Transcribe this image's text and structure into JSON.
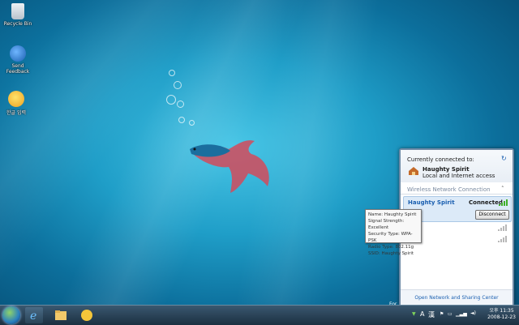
{
  "desktop": {
    "icons": [
      {
        "label": "Recycle Bin",
        "icon": "recycle-bin-icon"
      },
      {
        "label": "Send Feedback",
        "icon": "send-feedback-icon"
      },
      {
        "label": "한글 입력",
        "icon": "ime-app-icon"
      }
    ],
    "side_text": "For"
  },
  "network_flyout": {
    "connected_heading": "Currently connected to:",
    "refresh_icon": "refresh-icon",
    "current_network": {
      "name": "Haughty Spirit",
      "status": "Local and Internet access",
      "icon": "home-network-icon"
    },
    "section_title": "Wireless Network Connection",
    "section_collapse_icon": "chevron-up-icon",
    "selected_network": {
      "name": "Haughty Spirit",
      "state": "Connected",
      "button": "Disconnect"
    },
    "footer_link": "Open Network and Sharing Center"
  },
  "tooltip": {
    "lines": [
      "Name: Haughty Spirit",
      "Signal Strength: Excellent",
      "Security Type: WPA-PSK",
      "Radio Type: 802.11g",
      "SSID: Haughty Spirit"
    ]
  },
  "taskbar": {
    "tray_lang": "A",
    "tray_ime": "漢",
    "clock_time": "오후 11:35",
    "clock_date": "2008-12-23"
  },
  "colors": {
    "accent": "#1a5fb0",
    "signal_green": "#3fae2a",
    "signal_gray": "#b8b8b8"
  }
}
